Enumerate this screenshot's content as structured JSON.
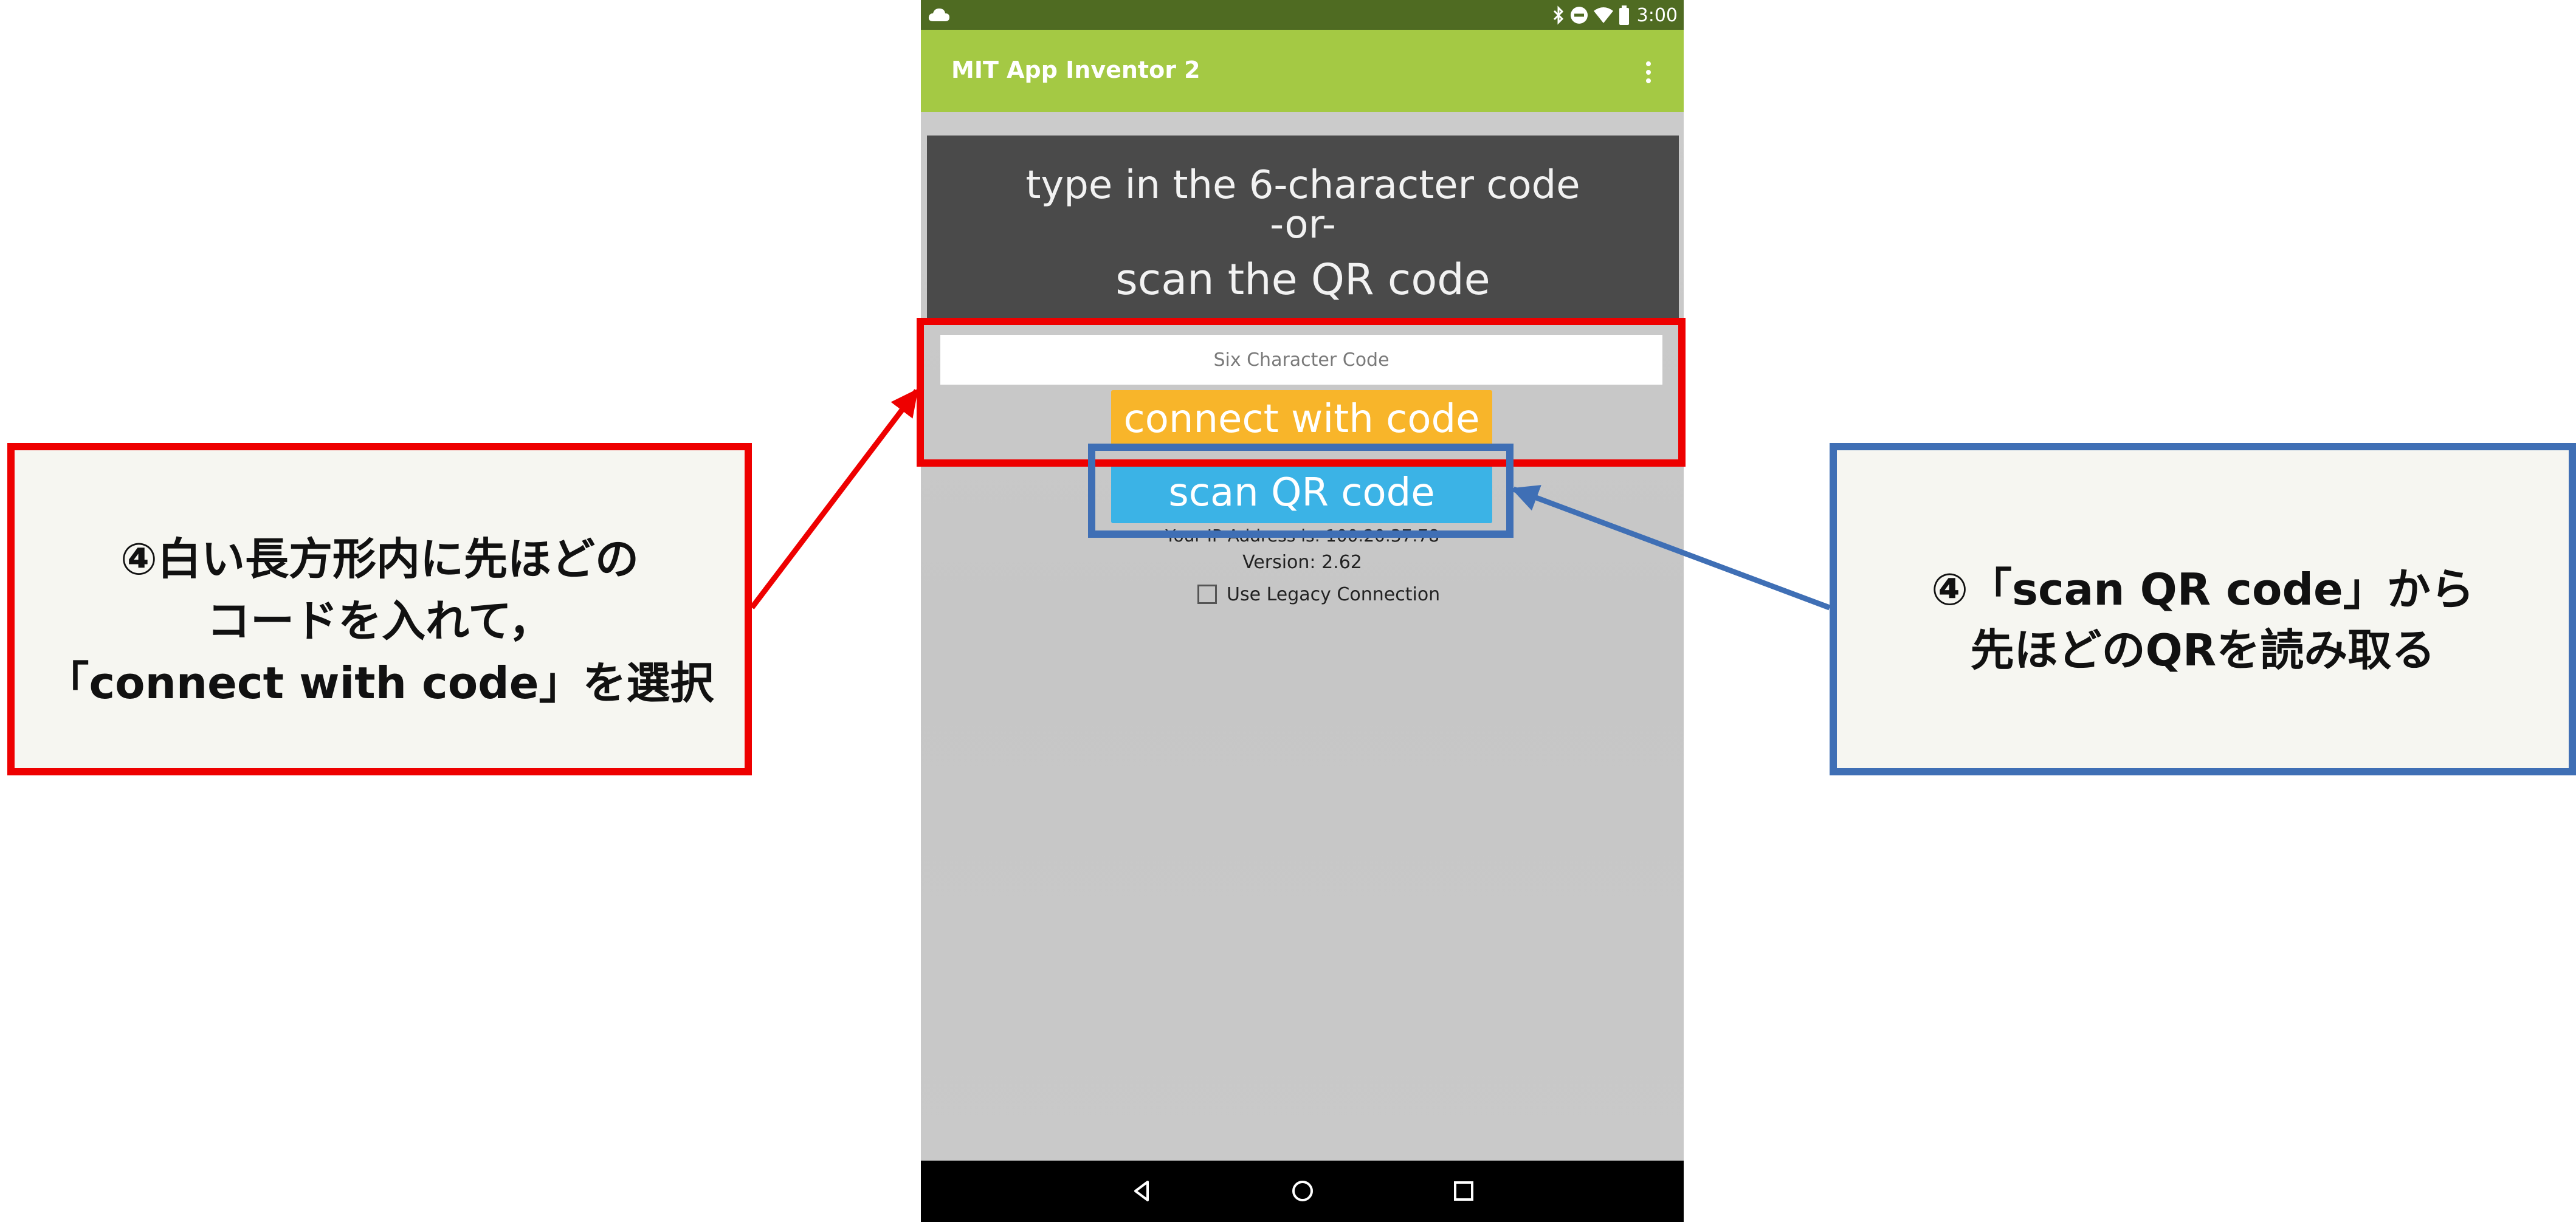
{
  "status_bar": {
    "time": "3:00",
    "icons": [
      "cloud-icon",
      "bluetooth-icon",
      "do-not-disturb-icon",
      "wifi-icon",
      "battery-icon"
    ]
  },
  "app_bar": {
    "title": "MIT App Inventor 2",
    "menu_icon": "overflow-menu-icon"
  },
  "prompt": {
    "line1": "type in the 6-character code",
    "line2": "-or-",
    "line3": "scan the QR code"
  },
  "code_input": {
    "placeholder": "Six Character Code",
    "value": ""
  },
  "buttons": {
    "connect": "connect with code",
    "scan": "scan QR code"
  },
  "info": {
    "ip_address": "Your IP Address is: 100.20.37.78",
    "version": "Version: 2.62"
  },
  "legacy": {
    "label": "Use Legacy Connection",
    "checked": false
  },
  "nav_bar": {
    "icons": [
      "back-icon",
      "home-icon",
      "recents-icon"
    ]
  },
  "annotations": {
    "red": {
      "line1": "④白い長方形内に先ほどの",
      "line2": "コードを入れて，",
      "line3": "「connect with code」を選択"
    },
    "blue": {
      "line1": "④「scan QR code」から",
      "line2": "先ほどのQRを読み取る"
    }
  },
  "colors": {
    "status_bar": "#4f6b22",
    "app_bar": "#a4c944",
    "connect_button": "#f8b52a",
    "scan_button": "#3bb3e6",
    "red_annotation": "#ee0000",
    "blue_annotation": "#3f6fb5"
  }
}
